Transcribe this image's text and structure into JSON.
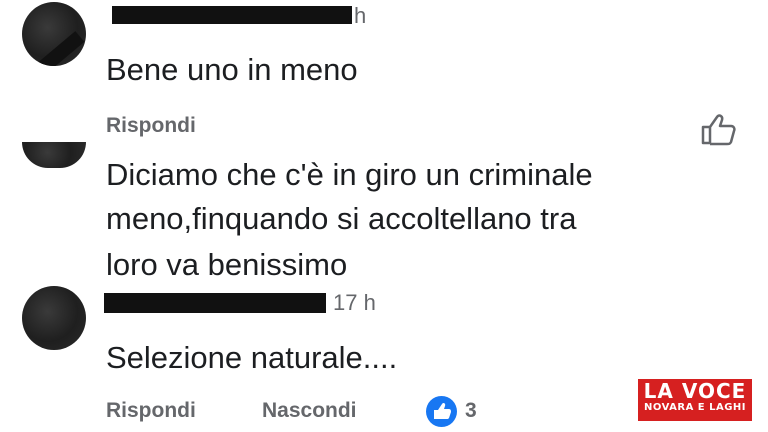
{
  "comments": [
    {
      "time": "h",
      "text": "Bene uno in meno",
      "reply_label": "Rispondi"
    },
    {
      "text_lines": [
        "Diciamo che c'è in giro un criminale",
        "meno,finquando si accoltellano tra",
        "loro va benissimo"
      ]
    },
    {
      "time": "17 h",
      "text": "Selezione naturale....",
      "reply_label": "Rispondi",
      "hide_label": "Nascondi",
      "reaction_count": "3"
    }
  ],
  "watermark": {
    "line1": "LA VOCE",
    "line2": "NOVARA E LAGHI",
    "color": "#d62020"
  },
  "icons": {
    "like": "thumbs-up-icon",
    "reaction": "like-reaction-icon"
  },
  "colors": {
    "meta_text": "#65676b",
    "like_blue": "#1877f2"
  }
}
